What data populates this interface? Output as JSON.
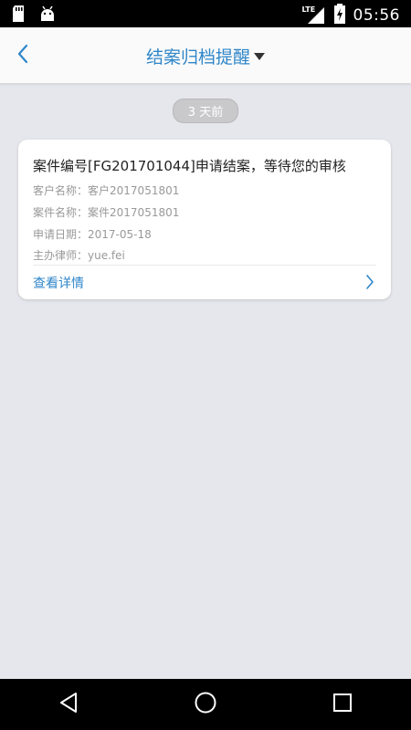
{
  "status_bar": {
    "time": "05:56",
    "network_label": "LTE",
    "icons": [
      "sd-card-icon",
      "android-icon",
      "signal-icon",
      "battery-charging-icon"
    ]
  },
  "nav": {
    "title": "结案归档提醒"
  },
  "timeline": {
    "label": "3 天前"
  },
  "card": {
    "title": "案件编号[FG201701044]申请结案，等待您的审核",
    "rows": [
      {
        "label": "客户名称：",
        "value": "客户2017051801"
      },
      {
        "label": "案件名称：",
        "value": "案件2017051801"
      },
      {
        "label": "申请日期：",
        "value": "2017-05-18"
      },
      {
        "label": "主办律师：",
        "value": "yue.fei"
      }
    ],
    "link_label": "查看详情"
  },
  "colors": {
    "accent": "#2f86c9",
    "background": "#e6e7ec"
  }
}
